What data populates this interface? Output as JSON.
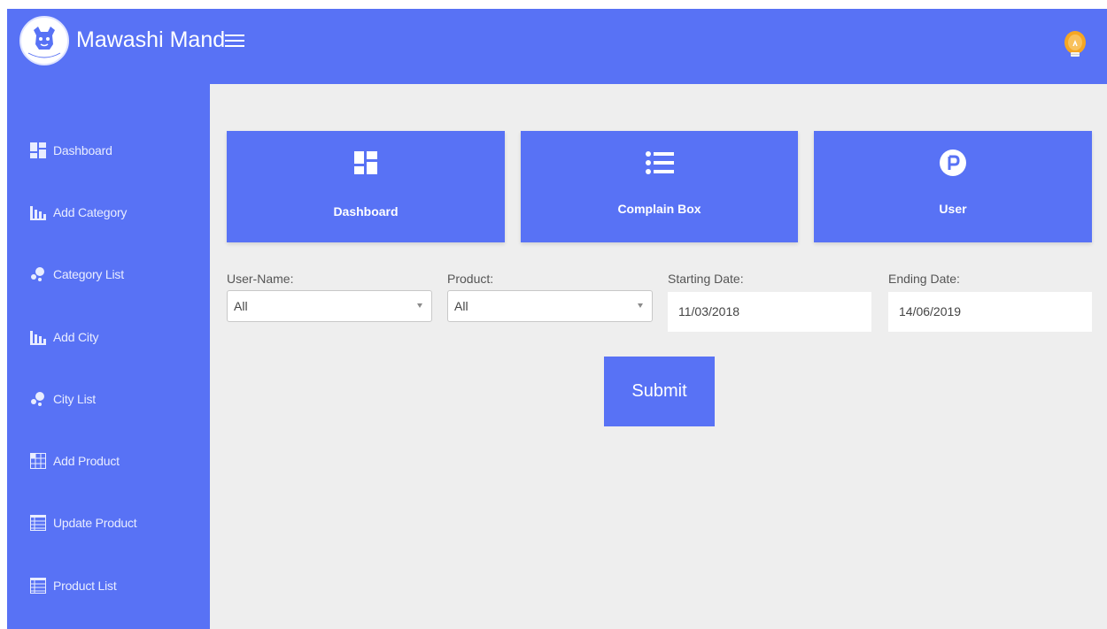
{
  "header": {
    "brand": "Mawashi Mand",
    "logo_text": "Mawashi Mandi"
  },
  "sidebar": {
    "items": [
      {
        "label": "Dashboard",
        "icon": "dashboard-icon"
      },
      {
        "label": "Add Category",
        "icon": "bar-chart-icon"
      },
      {
        "label": "Category List",
        "icon": "bubbles-icon"
      },
      {
        "label": "Add City",
        "icon": "bar-chart-icon"
      },
      {
        "label": "City List",
        "icon": "bubbles-icon"
      },
      {
        "label": "Add Product",
        "icon": "grid-add-icon"
      },
      {
        "label": "Update Product",
        "icon": "table-icon"
      },
      {
        "label": "Product List",
        "icon": "table-icon"
      }
    ]
  },
  "cards": [
    {
      "label": "Dashboard",
      "icon": "dashboard-icon"
    },
    {
      "label": "Complain Box",
      "icon": "list-icon"
    },
    {
      "label": "User",
      "icon": "parking-circle-icon"
    }
  ],
  "filters": {
    "user_name": {
      "label": "User-Name:",
      "value": "All"
    },
    "product": {
      "label": "Product:",
      "value": "All"
    },
    "starting_date": {
      "label": "Starting Date:",
      "value": "11/03/2018"
    },
    "ending_date": {
      "label": "Ending Date:",
      "value": "14/06/2019"
    }
  },
  "submit_label": "Submit",
  "colors": {
    "primary": "#5872f5",
    "background": "#eeeeee",
    "bulb": "#f5a623"
  }
}
